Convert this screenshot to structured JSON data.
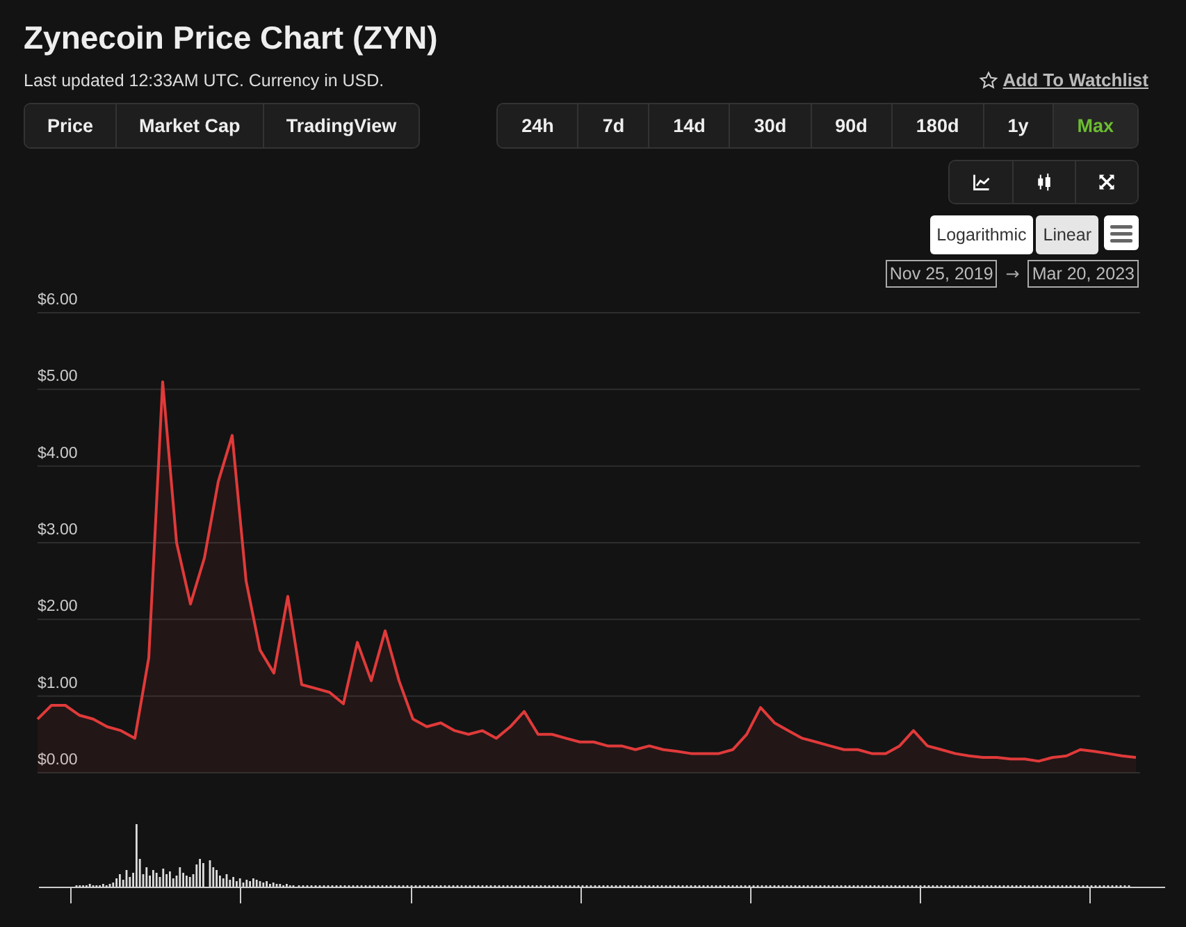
{
  "title": "Zynecoin Price Chart (ZYN)",
  "subtitle": "Last updated 12:33AM UTC. Currency in USD.",
  "watchlist": {
    "label": "Add To Watchlist"
  },
  "views": [
    {
      "label": "Price"
    },
    {
      "label": "Market Cap"
    },
    {
      "label": "TradingView"
    }
  ],
  "periods": [
    {
      "label": "24h",
      "selected": false
    },
    {
      "label": "7d",
      "selected": false
    },
    {
      "label": "14d",
      "selected": false
    },
    {
      "label": "30d",
      "selected": false
    },
    {
      "label": "90d",
      "selected": false
    },
    {
      "label": "180d",
      "selected": false
    },
    {
      "label": "1y",
      "selected": false
    },
    {
      "label": "Max",
      "selected": true
    }
  ],
  "chart_tools": [
    {
      "kind": "line"
    },
    {
      "kind": "candles"
    },
    {
      "kind": "expand"
    }
  ],
  "scales": [
    {
      "label": "Logarithmic",
      "selected": false
    },
    {
      "label": "Linear",
      "selected": true
    }
  ],
  "date_range": {
    "from": "Nov 25, 2019",
    "arrow": "→",
    "to": "Mar 20, 2023"
  },
  "chart_data": {
    "type": "area",
    "grid": true,
    "ylim": [
      0,
      6
    ],
    "yticks": [
      {
        "value": 0,
        "label": "$0.00"
      },
      {
        "value": 1,
        "label": "$1.00"
      },
      {
        "value": 2,
        "label": "$2.00"
      },
      {
        "value": 3,
        "label": "$3.00"
      },
      {
        "value": 4,
        "label": "$4.00"
      },
      {
        "value": 5,
        "label": "$5.00"
      },
      {
        "value": 6,
        "label": "$6.00"
      }
    ],
    "series": [
      {
        "color": "#e03a3a",
        "values": [
          0.7,
          0.88,
          0.88,
          0.75,
          0.7,
          0.6,
          0.55,
          0.45,
          1.5,
          5.1,
          3.0,
          2.2,
          2.8,
          3.8,
          4.4,
          2.5,
          1.6,
          1.3,
          2.3,
          1.15,
          1.1,
          1.05,
          0.9,
          1.7,
          1.2,
          1.85,
          1.2,
          0.7,
          0.6,
          0.65,
          0.55,
          0.5,
          0.55,
          0.45,
          0.6,
          0.8,
          0.5,
          0.5,
          0.45,
          0.4,
          0.4,
          0.35,
          0.35,
          0.3,
          0.35,
          0.3,
          0.28,
          0.25,
          0.25,
          0.25,
          0.3,
          0.5,
          0.85,
          0.65,
          0.55,
          0.45,
          0.4,
          0.35,
          0.3,
          0.3,
          0.25,
          0.25,
          0.35,
          0.55,
          0.35,
          0.3,
          0.25,
          0.22,
          0.2,
          0.2,
          0.18,
          0.18,
          0.15,
          0.2,
          0.22,
          0.3,
          0.28,
          0.25,
          0.22,
          0.2
        ]
      }
    ]
  }
}
